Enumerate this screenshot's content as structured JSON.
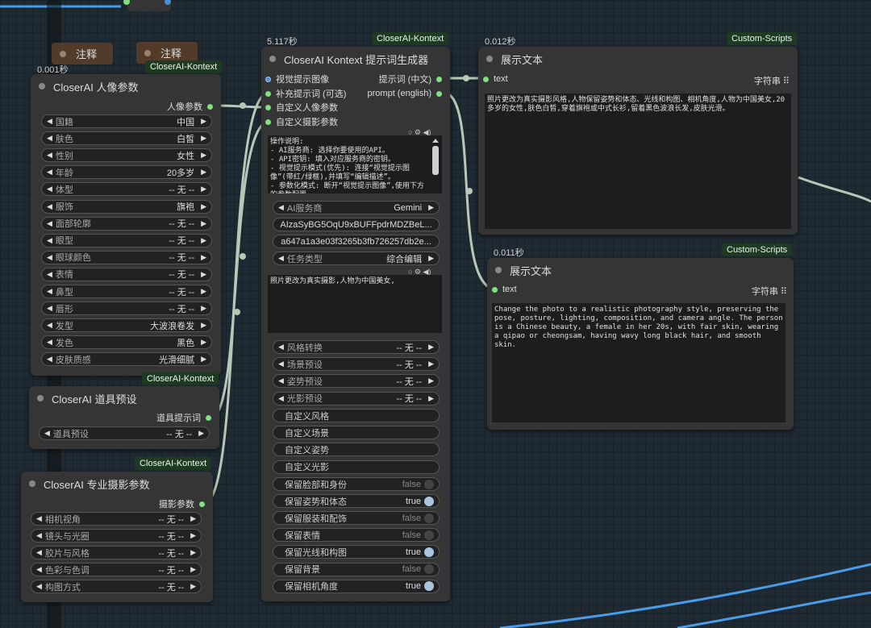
{
  "annotations": [
    "注释",
    "注释"
  ],
  "portrait_node": {
    "time": "0.001秒",
    "badge": "CloserAI-Kontext",
    "title": "CloserAI 人像参数",
    "output": "人像参数",
    "params": [
      {
        "label": "国籍",
        "value": "中国"
      },
      {
        "label": "肤色",
        "value": "白皙"
      },
      {
        "label": "性别",
        "value": "女性"
      },
      {
        "label": "年龄",
        "value": "20多岁"
      },
      {
        "label": "体型",
        "value": "-- 无 --"
      },
      {
        "label": "服饰",
        "value": "旗袍"
      },
      {
        "label": "面部轮廓",
        "value": "-- 无 --"
      },
      {
        "label": "眼型",
        "value": "-- 无 --"
      },
      {
        "label": "眼球颜色",
        "value": "-- 无 --"
      },
      {
        "label": "表情",
        "value": "-- 无 --"
      },
      {
        "label": "鼻型",
        "value": "-- 无 --"
      },
      {
        "label": "唇形",
        "value": "-- 无 --"
      },
      {
        "label": "发型",
        "value": "大波浪卷发"
      },
      {
        "label": "发色",
        "value": "黑色"
      },
      {
        "label": "皮肤质感",
        "value": "光滑细腻"
      }
    ]
  },
  "props_node": {
    "badge": "CloserAI-Kontext",
    "title": "CloserAI 道具预设",
    "output": "道具提示词",
    "params": [
      {
        "label": "道具预设",
        "value": "-- 无 --"
      }
    ]
  },
  "photo_node": {
    "badge": "CloserAI-Kontext",
    "title": "CloserAI 专业摄影参数",
    "output": "摄影参数",
    "params": [
      {
        "label": "相机视角",
        "value": "-- 无 --"
      },
      {
        "label": "镜头与光圈",
        "value": "-- 无 --"
      },
      {
        "label": "胶片与风格",
        "value": "-- 无 --"
      },
      {
        "label": "色彩与色调",
        "value": "-- 无 --"
      },
      {
        "label": "构图方式",
        "value": "-- 无 --"
      }
    ]
  },
  "prompt_node": {
    "time": "5.117秒",
    "badge": "CloserAI-Kontext",
    "title": "CloserAI Kontext 提示词生成器",
    "inputs": [
      "视觉提示图像",
      "补充提示词 (可选)",
      "自定义人像参数",
      "自定义摄影参数"
    ],
    "outputs": [
      "提示词 (中文)",
      "prompt (english)"
    ],
    "instructions": "操作说明:\n- AI服务商: 选择你要使用的API。\n- API密钥: 填入对应服务商的密钥。\n- 视觉提示模式(优先): 连接“视觉提示图像”(带红/绿框),并填写“编辑描述”。\n- 参数化模式: 断开“视觉提示图像”,使用下方的参数配置。",
    "ai_provider": {
      "label": "AI服务商",
      "value": "Gemini"
    },
    "api_key": "AIzaSyBG5OqU9xBUFFpdrMDZBeL...",
    "secret": "a647a1a3e03f3265b3fb726257db2e...",
    "task_type": {
      "label": "任务类型",
      "value": "综合编辑"
    },
    "edit_text": "照片更改为真实摄影,人物为中国美女,",
    "presets": [
      {
        "label": "风格转换",
        "value": "-- 无 --"
      },
      {
        "label": "场景预设",
        "value": "-- 无 --"
      },
      {
        "label": "姿势预设",
        "value": "-- 无 --"
      },
      {
        "label": "光影预设",
        "value": "-- 无 --"
      }
    ],
    "custom_fields": [
      "自定义风格",
      "自定义场景",
      "自定义姿势",
      "自定义光影"
    ],
    "toggles": [
      {
        "label": "保留脸部和身份",
        "value": "false"
      },
      {
        "label": "保留姿势和体态",
        "value": "true"
      },
      {
        "label": "保留服装和配饰",
        "value": "false"
      },
      {
        "label": "保留表情",
        "value": "false"
      },
      {
        "label": "保留光线和构图",
        "value": "true"
      },
      {
        "label": "保留背景",
        "value": "false"
      },
      {
        "label": "保留相机角度",
        "value": "true"
      }
    ]
  },
  "show_text_1": {
    "time": "0.012秒",
    "badge": "Custom-Scripts",
    "title": "展示文本",
    "input": "text",
    "type": "字符串",
    "content": "照片更改为真实摄影风格,人物保留姿势和体态、光线和构图、相机角度,人物为中国美女,20多岁的女性,肤色白皙,穿着旗袍或中式长衫,留着黑色波浪长发,皮肤光滑。"
  },
  "show_text_2": {
    "time": "0.011秒",
    "badge": "Custom-Scripts",
    "title": "展示文本",
    "input": "text",
    "type": "字符串",
    "content": "Change the photo to a realistic photography style, preserving the pose, posture, lighting, composition, and camera angle. The person is a Chinese beauty, a female in her 20s, with fair skin, wearing a qipao or cheongsam, having wavy long black hair, and smooth skin."
  },
  "colors": {
    "link": "#b8c8b8",
    "blue_link": "#4a9be8",
    "slot": "#7ee27e",
    "badge": "#1f3a22"
  }
}
